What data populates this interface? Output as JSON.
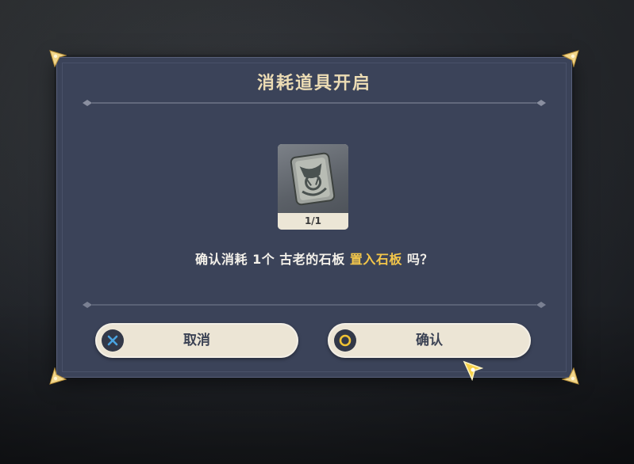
{
  "dialog": {
    "title": "消耗道具开启",
    "item": {
      "name": "古老的石板",
      "count_label": "1/1",
      "icon": "ancient-stone-slate-icon"
    },
    "message": {
      "prefix": "确认消耗 1个 古老的石板 ",
      "highlight": "置入石板",
      "suffix": " 吗？"
    },
    "buttons": {
      "cancel": {
        "label": "取消",
        "icon": "cross-button-icon"
      },
      "confirm": {
        "label": "确认",
        "icon": "circle-button-icon"
      }
    }
  },
  "colors": {
    "panel": "#3b4359",
    "title": "#ecdcb4",
    "highlight": "#f3c64a",
    "button_bg": "#ece5d5",
    "button_text": "#3b4254",
    "cross_icon": "#4aa3e0",
    "circle_icon": "#f0c233"
  }
}
